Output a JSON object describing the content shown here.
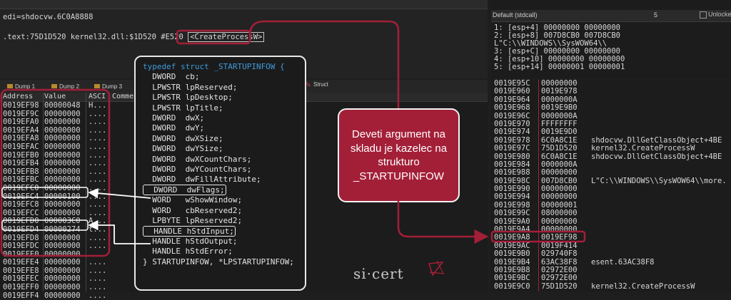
{
  "top_left": {
    "edi_line": "edi=shdocvw.6C0A8888",
    "address_line_prefix": ".text:75D1D520 kernel32.dll:$1D520 #E520 ",
    "address_tag": "<CreateProcessW>"
  },
  "top_right": {
    "calling_convention": "Default (stdcall)",
    "arg_count": "5",
    "unlock_label": "Unlocke",
    "stack_args": [
      "1: [esp+4] 00000000 00000000",
      "2: [esp+8] 007D8CB0 007D8CB0 L\"C:\\\\WINDOWS\\\\SysWOW64\\\\",
      "3: [esp+C] 00000000 00000000",
      "4: [esp+10] 00000000 00000000",
      "5: [esp+14] 00000001 00000001"
    ]
  },
  "tabs": [
    {
      "label": "Dump 1"
    },
    {
      "label": "Dump 2"
    },
    {
      "label": "Dump 3"
    }
  ],
  "struct_tab_label": "Struct",
  "dump": {
    "headers": [
      "Address",
      "Value",
      "ASCI",
      "Comme"
    ],
    "rows": [
      {
        "address": "0019EF98",
        "value": "00000048",
        "ascii": "H..."
      },
      {
        "address": "0019EF9C",
        "value": "00000000",
        "ascii": "...."
      },
      {
        "address": "0019EFA0",
        "value": "00000000",
        "ascii": "...."
      },
      {
        "address": "0019EFA4",
        "value": "00000000",
        "ascii": "...."
      },
      {
        "address": "0019EFA8",
        "value": "00000000",
        "ascii": "...."
      },
      {
        "address": "0019EFAC",
        "value": "00000000",
        "ascii": "...."
      },
      {
        "address": "0019EFB0",
        "value": "00000000",
        "ascii": "...."
      },
      {
        "address": "0019EFB4",
        "value": "00000000",
        "ascii": "...."
      },
      {
        "address": "0019EFB8",
        "value": "00000000",
        "ascii": "...."
      },
      {
        "address": "0019EFBC",
        "value": "00000000",
        "ascii": "...."
      },
      {
        "address": "0019EFC0",
        "value": "00000000",
        "ascii": "...."
      },
      {
        "address": "0019EFC4",
        "value": "00000100",
        "ascii": "...."
      },
      {
        "address": "0019EFC8",
        "value": "00000000",
        "ascii": "...."
      },
      {
        "address": "0019EFCC",
        "value": "00000000",
        "ascii": "...."
      },
      {
        "address": "0019EFD0",
        "value": "000003C0",
        "ascii": "A..."
      },
      {
        "address": "0019EFD4",
        "value": "00000274",
        "ascii": "t..."
      },
      {
        "address": "0019EFD8",
        "value": "00000000",
        "ascii": "...."
      },
      {
        "address": "0019EFDC",
        "value": "00000000",
        "ascii": "...."
      },
      {
        "address": "0019EFE0",
        "value": "00000000",
        "ascii": "...."
      },
      {
        "address": "0019EFE4",
        "value": "00000000",
        "ascii": "...."
      },
      {
        "address": "0019EFE8",
        "value": "00000000",
        "ascii": "...."
      },
      {
        "address": "0019EFEC",
        "value": "00000000",
        "ascii": "...."
      },
      {
        "address": "0019EFF0",
        "value": "00000000",
        "ascii": "...."
      },
      {
        "address": "0019EFF4",
        "value": "00000000",
        "ascii": "...."
      }
    ]
  },
  "stack": {
    "rows": [
      {
        "address": "0019E95C",
        "value": "00000000",
        "comment": ""
      },
      {
        "address": "0019E960",
        "value": "0019E978",
        "comment": ""
      },
      {
        "address": "0019E964",
        "value": "0000000A",
        "comment": ""
      },
      {
        "address": "0019E968",
        "value": "0019E9B0",
        "comment": ""
      },
      {
        "address": "0019E96C",
        "value": "0000000A",
        "comment": ""
      },
      {
        "address": "0019E970",
        "value": "FFFFFFFF",
        "comment": ""
      },
      {
        "address": "0019E974",
        "value": "0019E9D0",
        "comment": ""
      },
      {
        "address": "0019E978",
        "value": "6C0A8C1E",
        "comment": "shdocvw.DllGetClassObject+4BE"
      },
      {
        "address": "0019E97C",
        "value": "75D1D520",
        "comment": "kernel32.CreateProcessW"
      },
      {
        "address": "0019E980",
        "value": "6C0A8C1E",
        "comment": "shdocvw.DllGetClassObject+4BE"
      },
      {
        "address": "0019E984",
        "value": "0000000A",
        "comment": ""
      },
      {
        "address": "0019E988",
        "value": "00000000",
        "comment": ""
      },
      {
        "address": "0019E98C",
        "value": "007D8CB0",
        "comment": "L\"C:\\\\WINDOWS\\\\SysWOW64\\\\more."
      },
      {
        "address": "0019E990",
        "value": "00000000",
        "comment": ""
      },
      {
        "address": "0019E994",
        "value": "00000000",
        "comment": ""
      },
      {
        "address": "0019E998",
        "value": "00000001",
        "comment": ""
      },
      {
        "address": "0019E99C",
        "value": "08000000",
        "comment": ""
      },
      {
        "address": "0019E9A0",
        "value": "00000000",
        "comment": ""
      },
      {
        "address": "0019E9A4",
        "value": "00000000",
        "comment": ""
      },
      {
        "address": "0019E9A8",
        "value": "0019EF98",
        "comment": ""
      },
      {
        "address": "0019E9AC",
        "value": "0019F414",
        "comment": ""
      },
      {
        "address": "0019E9B0",
        "value": "029740F8",
        "comment": ""
      },
      {
        "address": "0019E9B4",
        "value": "63AC38F8",
        "comment": "esent.63AC38F8"
      },
      {
        "address": "0019E9B8",
        "value": "02972E00",
        "comment": ""
      },
      {
        "address": "0019E9BC",
        "value": "02972E00",
        "comment": ""
      },
      {
        "address": "0019E9C0",
        "value": "75D1D520",
        "comment": "kernel32.CreateProcessW"
      }
    ]
  },
  "struct_code": {
    "lines": [
      "typedef struct _STARTUPINFOW {",
      "  DWORD  cb;",
      "  LPWSTR lpReserved;",
      "  LPWSTR lpDesktop;",
      "  LPWSTR lpTitle;",
      "  DWORD  dwX;",
      "  DWORD  dwY;",
      "  DWORD  dwXSize;",
      "  DWORD  dwYSize;",
      "  DWORD  dwXCountChars;",
      "  DWORD  dwYCountChars;",
      "  DWORD  dwFillAttribute;",
      "  DWORD  dwFlags;",
      "  WORD   wShowWindow;",
      "  WORD   cbReserved2;",
      "  LPBYTE lpReserved2;",
      "  HANDLE hStdInput;",
      "  HANDLE hStdOutput;",
      "  HANDLE hStdError;",
      "} STARTUPINFOW, *LPSTARTUPINFOW;"
    ]
  },
  "callout_text": "Deveti argument na skladu je kazelec na strukturo _STARTUPINFOW",
  "logo_text": "si·cert",
  "colors": {
    "accent_red": "#a31f38",
    "keyword_blue": "#3d9bdc",
    "highlight_blue": "#2e4a6e"
  }
}
